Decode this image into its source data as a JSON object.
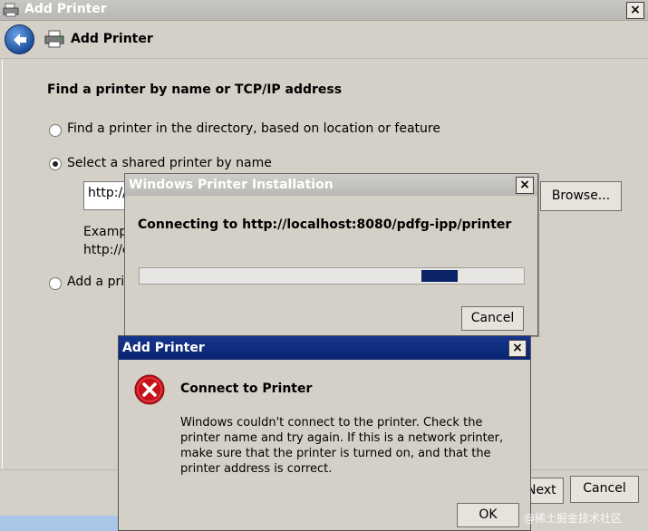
{
  "main_window": {
    "title": "Add Printer",
    "close_glyph": "×",
    "nav_title": "Add Printer",
    "heading": "Find a printer by name or TCP/IP address",
    "options": [
      {
        "label": "Find a printer in the directory, based on location or feature",
        "checked": false
      },
      {
        "label": "Select a shared printer by name",
        "checked": true
      },
      {
        "label": "Add a pri",
        "checked": false
      }
    ],
    "url_value": "http://",
    "browse_label": "Browse...",
    "example_line1": "Examp",
    "example_line2": "http://c",
    "next_label": "Next",
    "cancel_label": "Cancel"
  },
  "install_dialog": {
    "title": "Windows Printer Installation",
    "close_glyph": "×",
    "connecting_text": "Connecting to http://localhost:8080/pdfg-ipp/printer",
    "cancel_label": "Cancel",
    "progress_position": 0.78
  },
  "error_dialog": {
    "title": "Add Printer",
    "close_glyph": "×",
    "heading": "Connect to Printer",
    "message": "Windows couldn't connect to the printer. Check the printer name and try again. If this is a network printer, make sure that the printer is turned on, and that the printer address is correct.",
    "ok_label": "OK"
  },
  "watermark": "@稀土掘金技术社区",
  "colors": {
    "error_titlebar": "#0a2470",
    "progress_chunk": "#0b2367",
    "error_icon": "#c8101a"
  }
}
